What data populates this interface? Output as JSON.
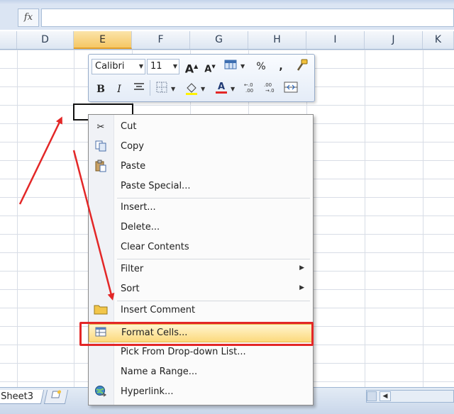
{
  "formula_bar": {
    "fx_label": "fx",
    "value": ""
  },
  "columns": [
    "D",
    "E",
    "F",
    "G",
    "H",
    "I",
    "J",
    "K"
  ],
  "selected_column": "E",
  "mini_toolbar": {
    "font_name": "Calibri",
    "font_size": "11",
    "buttons": [
      "grow-font",
      "shrink-font",
      "format-table",
      "percent",
      "comma",
      "format-painter",
      "bold",
      "italic",
      "center",
      "borders",
      "fill-color",
      "font-color",
      "decrease-decimal",
      "increase-decimal",
      "merge"
    ],
    "bold_label": "B",
    "italic_label": "I",
    "percent_label": "%",
    "comma_label": ","
  },
  "context_menu": {
    "items": [
      {
        "label": "Cut",
        "icon": "scissors-icon"
      },
      {
        "label": "Copy",
        "icon": "copy-icon"
      },
      {
        "label": "Paste",
        "icon": "paste-icon"
      },
      {
        "label": "Paste Special...",
        "icon": ""
      },
      {
        "label": "Insert...",
        "icon": ""
      },
      {
        "label": "Delete...",
        "icon": ""
      },
      {
        "label": "Clear Contents",
        "icon": ""
      },
      {
        "label": "Filter",
        "icon": "",
        "submenu": true
      },
      {
        "label": "Sort",
        "icon": "",
        "submenu": true
      },
      {
        "label": "Insert Comment",
        "icon": "comment-icon"
      },
      {
        "label": "Format Cells...",
        "icon": "format-cells-icon",
        "highlighted": true
      },
      {
        "label": "Pick From Drop-down List...",
        "icon": ""
      },
      {
        "label": "Name a Range...",
        "icon": ""
      },
      {
        "label": "Hyperlink...",
        "icon": "hyperlink-icon"
      }
    ]
  },
  "sheet_tabs": {
    "active": "Sheet3"
  },
  "colors": {
    "highlight_frame": "#e32727",
    "annotation_arrow": "#e32727",
    "selected_header": "#f5c764"
  }
}
